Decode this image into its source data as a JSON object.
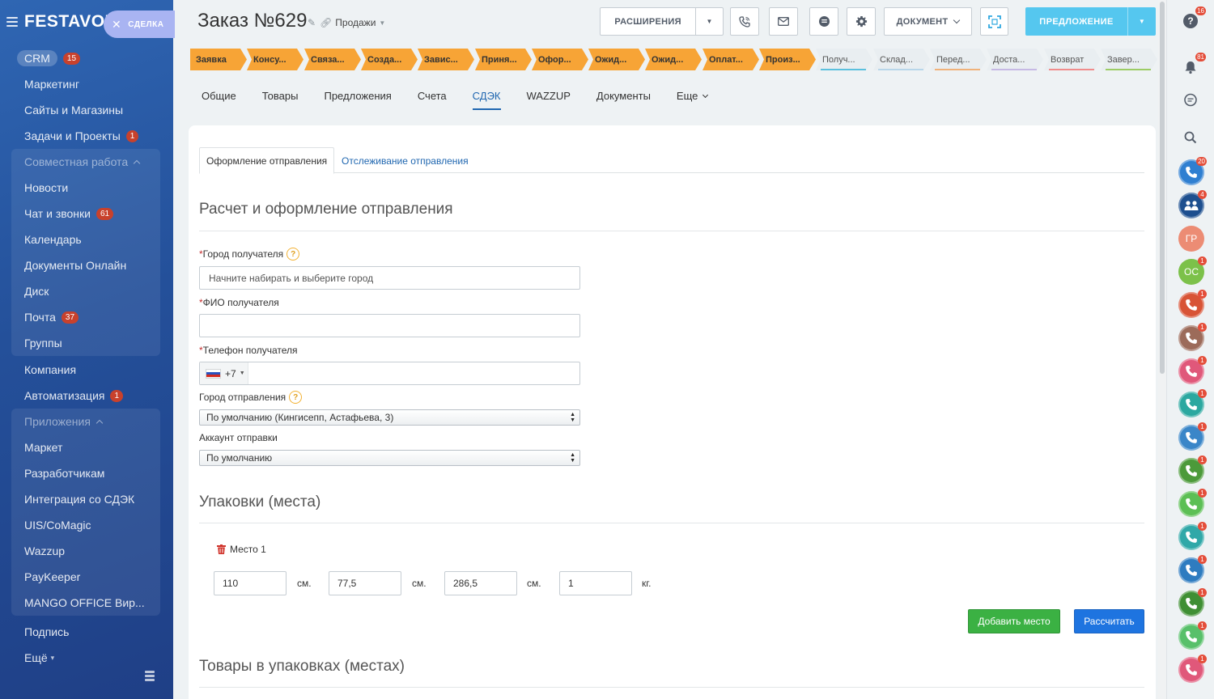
{
  "sidebar": {
    "logo": "FESTAVOL",
    "entity_tag": "СДЕЛКА",
    "crm": {
      "label": "CRM",
      "badge": "15"
    },
    "marketing": "Маркетинг",
    "sites": "Сайты и Магазины",
    "tasks": {
      "label": "Задачи и Проекты",
      "badge": "1"
    },
    "collab": {
      "label": "Совместная работа",
      "news": "Новости",
      "chat": {
        "label": "Чат и звонки",
        "badge": "61"
      },
      "calendar": "Календарь",
      "docs_online": "Документы Онлайн",
      "disk": "Диск",
      "mail": {
        "label": "Почта",
        "badge": "37"
      },
      "groups": "Группы"
    },
    "company": "Компания",
    "automation": {
      "label": "Автоматизация",
      "badge": "1"
    },
    "apps": {
      "label": "Приложения",
      "market": "Маркет",
      "developers": "Разработчикам",
      "cdek": "Интеграция со СДЭК",
      "uis": "UIS/CoMagic",
      "wazzup": "Wazzup",
      "paykeeper": "PayKeeper",
      "mango": "MANGO OFFICE Вир..."
    },
    "subscription": "Подпись",
    "more": "Ещё"
  },
  "header": {
    "title": "Заказ №629",
    "pipeline": "Продажи",
    "extensions_label": "РАСШИРЕНИЯ",
    "document_label": "ДОКУМЕНТ",
    "offer_label": "ПРЕДЛОЖЕНИЕ"
  },
  "stages": [
    {
      "label": "Заявка",
      "state": "done"
    },
    {
      "label": "Консу...",
      "state": "done"
    },
    {
      "label": "Связа...",
      "state": "done"
    },
    {
      "label": "Созда...",
      "state": "done"
    },
    {
      "label": "Завис...",
      "state": "done"
    },
    {
      "label": "Приня...",
      "state": "done"
    },
    {
      "label": "Офор...",
      "state": "done"
    },
    {
      "label": "Ожид...",
      "state": "done"
    },
    {
      "label": "Ожид...",
      "state": "done"
    },
    {
      "label": "Оплат...",
      "state": "done"
    },
    {
      "label": "Произ...",
      "state": "done"
    },
    {
      "label": "Получ...",
      "state": "todo",
      "color": "#5bc0de"
    },
    {
      "label": "Склад...",
      "state": "todo",
      "color": "#b8d6ea"
    },
    {
      "label": "Перед...",
      "state": "todo",
      "color": "#f0b27a"
    },
    {
      "label": "Доста...",
      "state": "todo",
      "color": "#c6b9e4"
    },
    {
      "label": "Возврат",
      "state": "todo",
      "color": "#f08c8c"
    },
    {
      "label": "Завер...",
      "state": "todo",
      "color": "#9ccc65"
    }
  ],
  "tabs": {
    "general": "Общие",
    "products": "Товары",
    "offers": "Предложения",
    "invoices": "Счета",
    "cdek": "СДЭК",
    "wazzup": "WAZZUP",
    "documents": "Документы",
    "more": "Еще"
  },
  "subtabs": {
    "create": "Оформление отправления",
    "tracking": "Отслеживание отправления"
  },
  "form": {
    "section_title": "Расчет и оформление отправления",
    "city_label": "Город получателя",
    "city_placeholder": "Начните набирать и выберите город",
    "city_value": "",
    "fio_label": "ФИО получателя",
    "fio_value": "",
    "phone_label": "Телефон получателя",
    "phone_code": "+7",
    "phone_value": "",
    "from_city_label": "Город отправления",
    "from_city_value": "По умолчанию (Кингисепп, Астафьева, 3)",
    "account_label": "Аккаунт отправки",
    "account_value": "По умолчанию"
  },
  "packages": {
    "section_title": "Упаковки (места)",
    "place_label": "Место 1",
    "length": "110",
    "width": "77,5",
    "height": "286,5",
    "weight": "1",
    "unit_cm": "см.",
    "unit_kg": "кг.",
    "add_button": "Добавить место",
    "calc_button": "Рассчитать"
  },
  "goods": {
    "section_title": "Товары в упаковках (местах)"
  },
  "rail": {
    "help_badge": "16",
    "notif_badge": "81",
    "avatars": [
      {
        "kind": "phone",
        "color": "#2f7fd1",
        "badge": "20"
      },
      {
        "kind": "group",
        "color": "#1d4f8f",
        "badge": "4"
      },
      {
        "kind": "text",
        "text": "ГР",
        "color": "#ec8c74",
        "badge": ""
      },
      {
        "kind": "text",
        "text": "ОС",
        "color": "#7cc14a",
        "badge": "1"
      },
      {
        "kind": "phone",
        "color": "#d85436",
        "badge": "1"
      },
      {
        "kind": "phone",
        "color": "#9c6b5a",
        "badge": "1"
      },
      {
        "kind": "phone",
        "color": "#e0587a",
        "badge": "1"
      },
      {
        "kind": "phone",
        "color": "#2ca8a0",
        "badge": "1"
      },
      {
        "kind": "phone",
        "color": "#3a86c8",
        "badge": "1"
      },
      {
        "kind": "phone",
        "color": "#4c9a3a",
        "badge": "1"
      },
      {
        "kind": "phone",
        "color": "#5cbf55",
        "badge": "1"
      },
      {
        "kind": "phone",
        "color": "#30a8a8",
        "badge": "1"
      },
      {
        "kind": "phone",
        "color": "#2e7cc0",
        "badge": "1"
      },
      {
        "kind": "phone",
        "color": "#3f8f34",
        "badge": "1"
      },
      {
        "kind": "phone",
        "color": "#58c06a",
        "badge": "1"
      },
      {
        "kind": "phone",
        "color": "#e0587a",
        "badge": "1"
      }
    ]
  }
}
